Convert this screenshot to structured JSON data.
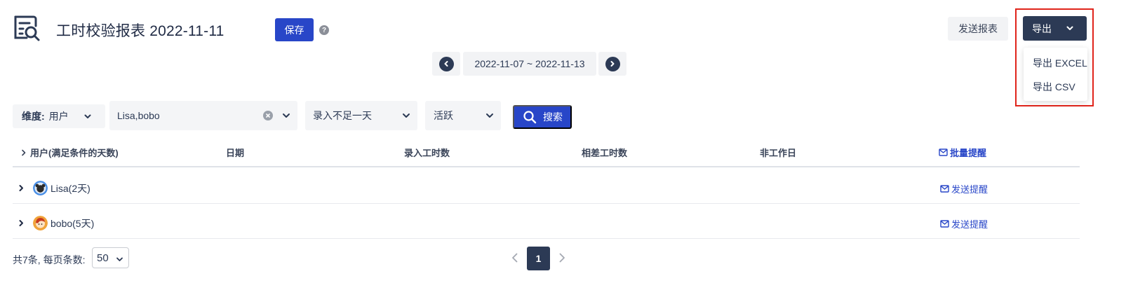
{
  "header": {
    "title": "工时校验报表 2022-11-11",
    "save_label": "保存",
    "help_icon": "?"
  },
  "week_nav": {
    "range": "2022-11-07 ~ 2022-11-13"
  },
  "actions": {
    "send_report_label": "发送报表",
    "export_label": "导出",
    "export_menu": [
      "导出 EXCEL",
      "导出 CSV"
    ]
  },
  "filters": {
    "dimension_label": "维度:",
    "dimension_value": "用户",
    "users_value": "Lisa,bobo",
    "entry_value": "录入不足一天",
    "active_value": "活跃",
    "search_label": "搜索"
  },
  "table": {
    "columns": [
      "用户(满足条件的天数)",
      "日期",
      "录入工时数",
      "相差工时数",
      "非工作日",
      "批量提醒"
    ],
    "rows": [
      {
        "user": "Lisa(2天)",
        "action": "发送提醒"
      },
      {
        "user": "bobo(5天)",
        "action": "发送提醒"
      }
    ]
  },
  "pagination": {
    "summary": "共7条, 每页条数:",
    "page_size": "50",
    "current_page": "1"
  },
  "colors": {
    "primary": "#2846c8",
    "dark": "#2c3a55",
    "highlight": "#e0241b"
  }
}
